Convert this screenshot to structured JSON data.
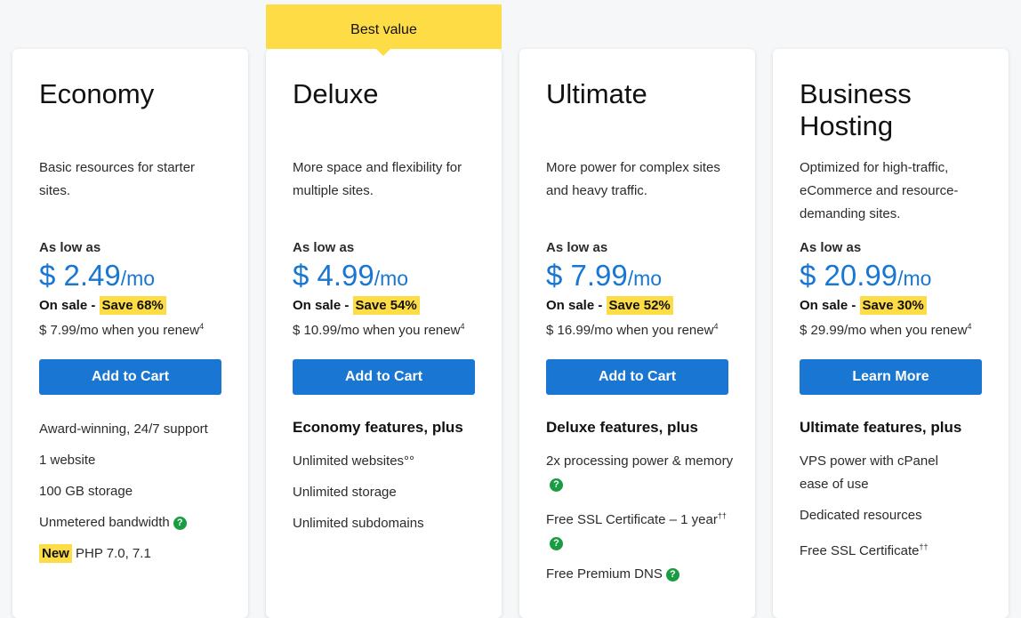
{
  "badge": "Best value",
  "plans": [
    {
      "title": "Economy",
      "description": "Basic resources for starter sites.",
      "as_low_as": "As low as",
      "price": "$ 2.49",
      "per": "/mo",
      "sale_prefix": "On sale -",
      "save": "Save 68%",
      "renew": "$ 7.99/mo when you renew",
      "renew_note": "4",
      "button": "Add to Cart",
      "feature_heading": "",
      "features": [
        {
          "text": "Award-winning, 24/7 support"
        },
        {
          "text": "1 website"
        },
        {
          "text": "100 GB storage"
        },
        {
          "text": "Unmetered bandwidth",
          "help": "?"
        },
        {
          "tag": "New",
          "text": " PHP 7.0, 7.1"
        }
      ]
    },
    {
      "title": "Deluxe",
      "description": "More space and flexibility for multiple sites.",
      "as_low_as": "As low as",
      "price": "$ 4.99",
      "per": "/mo",
      "sale_prefix": "On sale -",
      "save": "Save 54%",
      "renew": "$ 10.99/mo when you renew",
      "renew_note": "4",
      "button": "Add to Cart",
      "feature_heading": "Economy features, plus",
      "features": [
        {
          "text": "Unlimited websites°°"
        },
        {
          "text": "Unlimited storage"
        },
        {
          "text": "Unlimited subdomains"
        }
      ]
    },
    {
      "title": "Ultimate",
      "description": "More power for complex sites and heavy traffic.",
      "as_low_as": "As low as",
      "price": "$ 7.99",
      "per": "/mo",
      "sale_prefix": "On sale -",
      "save": "Save 52%",
      "renew": "$ 16.99/mo when you renew",
      "renew_note": "4",
      "button": "Add to Cart",
      "feature_heading": "Deluxe features, plus",
      "features": [
        {
          "text": "2x processing power & memory",
          "help": "?"
        },
        {
          "text": "Free SSL Certificate – 1 year",
          "note": "††",
          "help": "?"
        },
        {
          "text": "Free Premium DNS",
          "help": "?"
        }
      ]
    },
    {
      "title": "Business Hosting",
      "description": "Optimized for high-traffic, eCommerce and resource-demanding sites.",
      "as_low_as": "As low as",
      "price": "$ 20.99",
      "per": "/mo",
      "sale_prefix": "On sale -",
      "save": "Save 30%",
      "renew": "$ 29.99/mo when you renew",
      "renew_note": "4",
      "button": "Learn More",
      "feature_heading": "Ultimate features, plus",
      "features": [
        {
          "text": "VPS power with cPanel ease of use"
        },
        {
          "text": "Dedicated resources"
        },
        {
          "text": "Free SSL Certificate",
          "note": "††"
        }
      ]
    }
  ],
  "colors": {
    "accent": "#1976d2",
    "highlight": "#fedc45",
    "help": "#1a9c43"
  },
  "icons": {
    "help": "question-circle-icon"
  }
}
